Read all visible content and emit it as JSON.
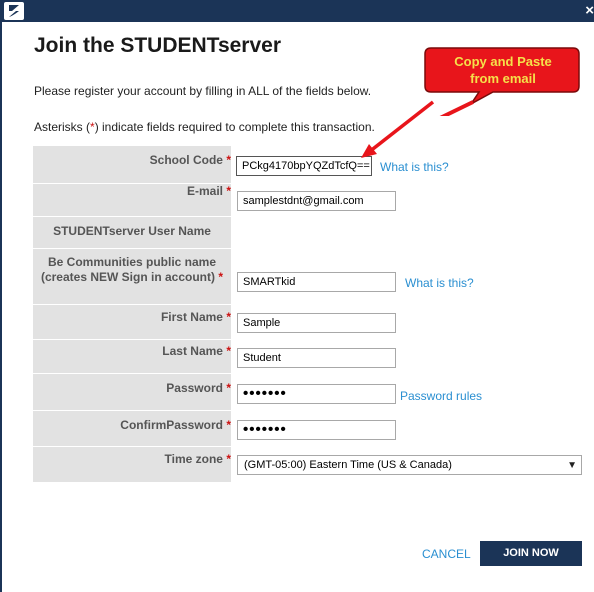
{
  "window": {
    "close_symbol": "×"
  },
  "heading": "Join the STUDENTserver",
  "intro": {
    "line1": "Please register your account by filling in ALL of the fields below.",
    "line2_prefix": "Asterisks (",
    "line2_asterisk": "*",
    "line2_suffix": ") indicate fields required to complete this transaction."
  },
  "callout": {
    "line1": "Copy and Paste",
    "line2": "from email",
    "fill_color": "#e8151b",
    "text_color": "#f5e04a"
  },
  "form": {
    "required_mark": "*",
    "school_code": {
      "label": "School Code",
      "value": "PCkg4170bpYQZdTcfQ==",
      "help": "What is this?"
    },
    "email": {
      "label": "E-mail",
      "value": "samplestdnt@gmail.com"
    },
    "user_name": {
      "label": "STUDENTserver User Name"
    },
    "public_name": {
      "label_line1": "Be Communities public name",
      "label_line2": "(creates NEW Sign in account)",
      "value": "SMARTkid",
      "help": "What is this?"
    },
    "first_name": {
      "label": "First Name",
      "value": "Sample"
    },
    "last_name": {
      "label": "Last Name",
      "value": "Student"
    },
    "password": {
      "label": "Password",
      "value": "•••••••",
      "help": "Password rules"
    },
    "confirm_password": {
      "label": "ConfirmPassword",
      "value": "•••••••"
    },
    "time_zone": {
      "label": "Time zone",
      "value": "(GMT-05:00) Eastern Time (US & Canada)"
    }
  },
  "actions": {
    "cancel": "CANCEL",
    "join": "JOIN NOW"
  },
  "colors": {
    "titlebar": "#1b3457",
    "label_bg": "#e2e2e2",
    "link": "#2a8fd1",
    "asterisk": "#cc1111"
  }
}
